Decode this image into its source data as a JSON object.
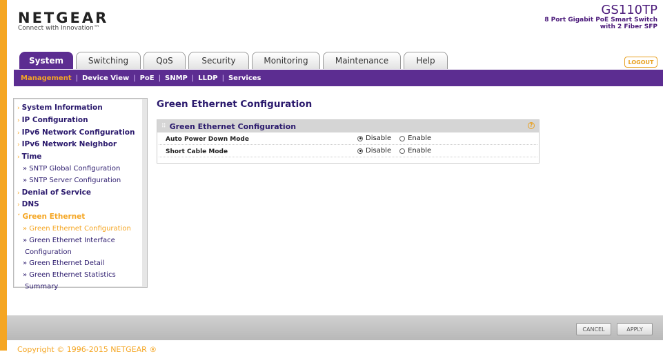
{
  "brand": {
    "logo": "NETGEAR",
    "tagline": "Connect with Innovation™",
    "model": "GS110TP",
    "description_line1": "8 Port Gigabit PoE Smart Switch",
    "description_line2": "with 2 Fiber SFP"
  },
  "tabs": [
    {
      "label": "System",
      "active": true
    },
    {
      "label": "Switching",
      "active": false
    },
    {
      "label": "QoS",
      "active": false
    },
    {
      "label": "Security",
      "active": false
    },
    {
      "label": "Monitoring",
      "active": false
    },
    {
      "label": "Maintenance",
      "active": false
    },
    {
      "label": "Help",
      "active": false
    }
  ],
  "logout_label": "LOGOUT",
  "subnav": [
    {
      "label": "Management",
      "active": true
    },
    {
      "label": "Device View",
      "active": false
    },
    {
      "label": "PoE",
      "active": false
    },
    {
      "label": "SNMP",
      "active": false
    },
    {
      "label": "LLDP",
      "active": false
    },
    {
      "label": "Services",
      "active": false
    }
  ],
  "sidebar": {
    "items": [
      {
        "label": "System Information"
      },
      {
        "label": "IP Configuration"
      },
      {
        "label": "IPv6 Network Configuration"
      },
      {
        "label": "IPv6 Network Neighbor"
      },
      {
        "label": "Time"
      },
      {
        "label": "» SNTP Global Configuration"
      },
      {
        "label": "» SNTP Server Configuration"
      },
      {
        "label": "Denial of Service"
      },
      {
        "label": "DNS"
      },
      {
        "label": "Green Ethernet"
      },
      {
        "label": "» Green Ethernet Configuration"
      },
      {
        "label": "» Green Ethernet Interface"
      },
      {
        "label": "Configuration"
      },
      {
        "label": "» Green Ethernet Detail"
      },
      {
        "label": "» Green Ethernet Statistics"
      },
      {
        "label": "Summary"
      }
    ]
  },
  "main": {
    "title": "Green Ethernet Configuration",
    "panel_title": "Green Ethernet Configuration",
    "help_icon": "?",
    "rows": [
      {
        "label": "Auto Power Down Mode",
        "option1": "Disable",
        "option2": "Enable",
        "selected": "Disable"
      },
      {
        "label": "Short Cable Mode",
        "option1": "Disable",
        "option2": "Enable",
        "selected": "Disable"
      }
    ]
  },
  "buttons": {
    "cancel": "CANCEL",
    "apply": "APPLY"
  },
  "copyright": "Copyright © 1996-2015 NETGEAR ®",
  "colors": {
    "accent_purple": "#5c2d91",
    "accent_orange": "#f5a623",
    "nav_text": "#2b1a6d"
  }
}
